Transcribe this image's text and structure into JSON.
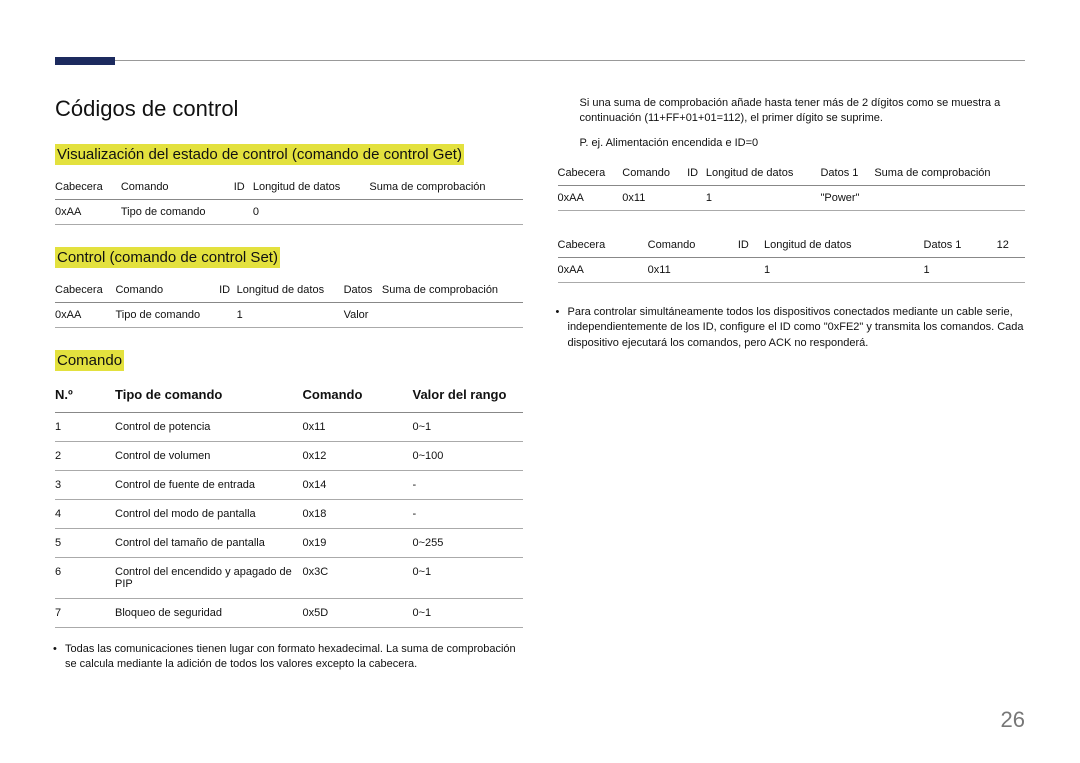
{
  "page_number": "26",
  "title": "Códigos de control",
  "headings": {
    "get": "Visualización del estado de control (comando de control Get)",
    "set": "Control (comando de control Set)",
    "comando": "Comando"
  },
  "specHeaders": {
    "cabecera": "Cabecera",
    "comando": "Comando",
    "id": "ID",
    "longitud": "Longitud de datos",
    "suma": "Suma de comprobación",
    "datos": "Datos",
    "datos1": "Datos 1"
  },
  "getRow": {
    "c0": "0xAA",
    "c1": "Tipo de comando",
    "c3": "0"
  },
  "setRow": {
    "c0": "0xAA",
    "c1": "Tipo de comando",
    "c3": "1",
    "c4": "Valor"
  },
  "cmdTable": {
    "h0": "N.º",
    "h1": "Tipo de comando",
    "h2": "Comando",
    "h3": "Valor del rango",
    "rows": [
      {
        "n": "1",
        "t": "Control de potencia",
        "c": "0x11",
        "v": "0~1"
      },
      {
        "n": "2",
        "t": "Control de volumen",
        "c": "0x12",
        "v": "0~100"
      },
      {
        "n": "3",
        "t": "Control de fuente de entrada",
        "c": "0x14",
        "v": "-"
      },
      {
        "n": "4",
        "t": "Control del modo de pantalla",
        "c": "0x18",
        "v": "-"
      },
      {
        "n": "5",
        "t": "Control del tamaño de pantalla",
        "c": "0x19",
        "v": "0~255"
      },
      {
        "n": "6",
        "t": "Control del encendido y apagado de PIP",
        "c": "0x3C",
        "v": "0~1"
      },
      {
        "n": "7",
        "t": "Bloqueo de seguridad",
        "c": "0x5D",
        "v": "0~1"
      }
    ]
  },
  "note1": "Todas las comunicaciones tienen lugar con formato hexadecimal. La suma de comprobación se calcula mediante la adición de todos los valores excepto la cabecera.",
  "right": {
    "para1": "Si una suma de comprobación añade hasta tener más de 2 dígitos como se muestra a continuación (11+FF+01+01=112), el primer dígito se suprime.",
    "example": "P. ej. Alimentación encendida e ID=0",
    "t1": {
      "r": {
        "c0": "0xAA",
        "c1": "0x11",
        "c3": "1",
        "c4": "\"Power\""
      }
    },
    "t2": {
      "suma": "12",
      "r": {
        "c0": "0xAA",
        "c1": "0x11",
        "c3": "1",
        "c4": "1"
      }
    },
    "note2": "Para controlar simultáneamente todos los dispositivos conectados mediante un cable serie, independientemente de los ID, configure el ID como \"0xFE2\" y transmita los comandos. Cada dispositivo ejecutará los comandos, pero ACK no responderá."
  }
}
